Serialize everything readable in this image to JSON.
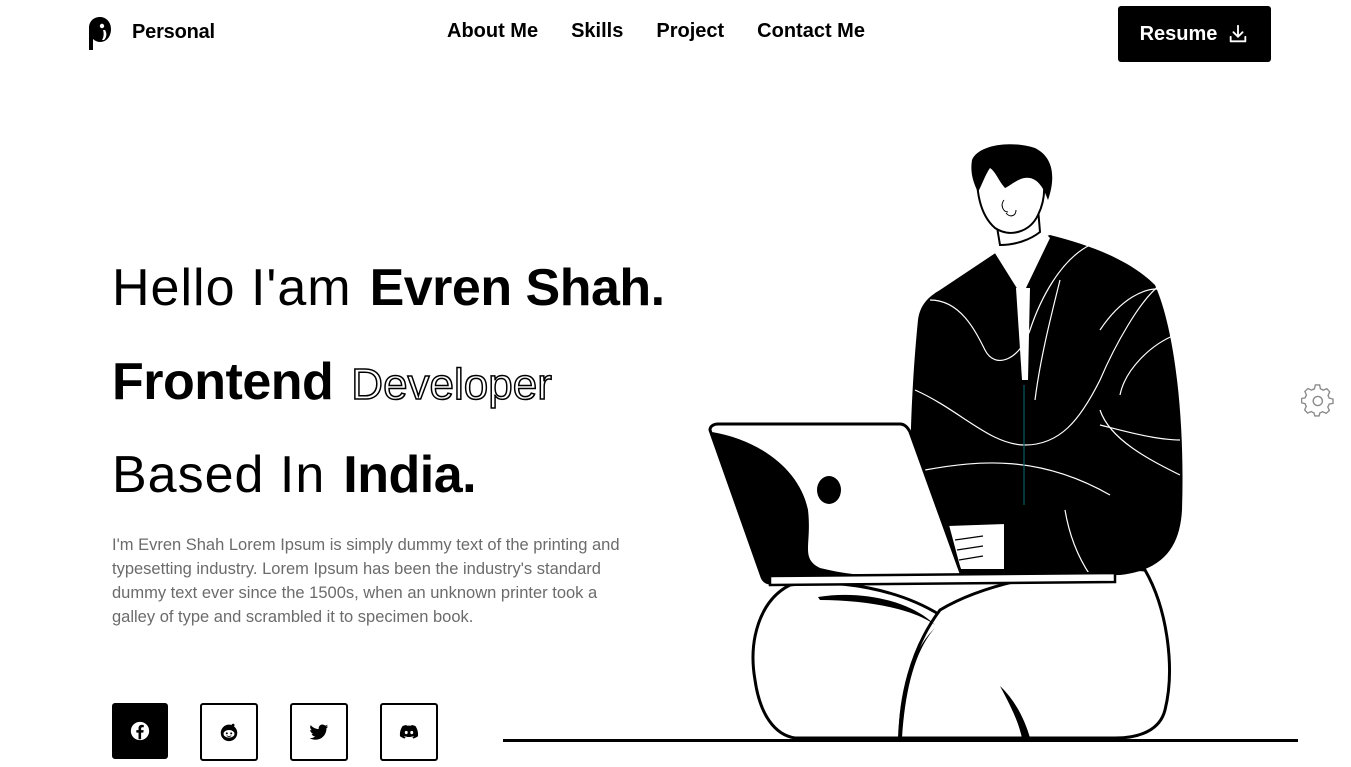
{
  "brand": {
    "name": "Personal",
    "logo_icon": "penguin-logo-icon"
  },
  "nav": {
    "items": [
      {
        "label": "About Me"
      },
      {
        "label": "Skills"
      },
      {
        "label": "Project"
      },
      {
        "label": "Contact Me"
      }
    ],
    "resume_label": "Resume",
    "resume_icon": "download-icon"
  },
  "hero": {
    "line1_light": "Hello I'am",
    "line1_bold": "Evren Shah.",
    "line2_bold": "Frontend",
    "line2_outline": "Developer",
    "line3_light": "Based In",
    "line3_bold": "India.",
    "description": "I'm Evren Shah Lorem Ipsum is simply dummy text of the printing and typesetting industry. Lorem Ipsum has been the industry's standard dummy text ever since the 1500s, when an unknown printer took a galley of type and scrambled it to specimen book."
  },
  "social": [
    {
      "icon": "facebook-icon"
    },
    {
      "icon": "reddit-icon"
    },
    {
      "icon": "twitter-icon"
    },
    {
      "icon": "discord-icon"
    }
  ],
  "settings_icon": "gear-icon",
  "colors": {
    "primary": "#000000",
    "background": "#ffffff",
    "text_muted": "#6b6b6b"
  }
}
